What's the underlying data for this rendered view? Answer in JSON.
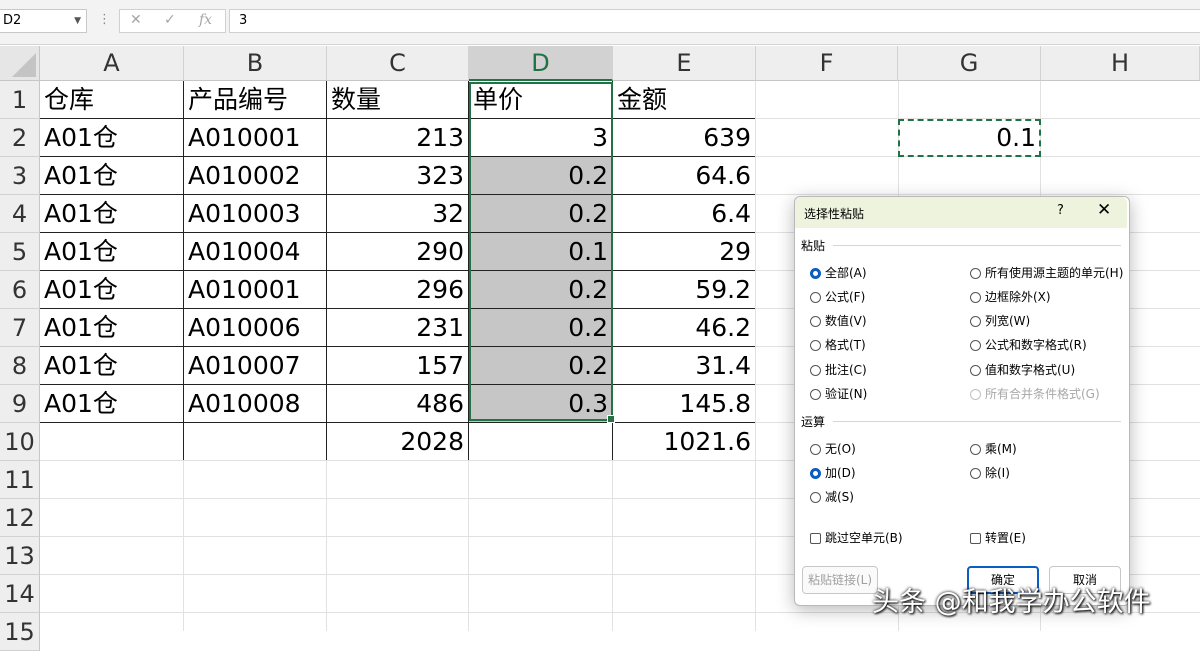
{
  "formula_bar": {
    "name_box": "D2",
    "cancel_symbol": "✕",
    "enter_symbol": "✓",
    "function_symbol": "fx",
    "formula": "3"
  },
  "columns": [
    "A",
    "B",
    "C",
    "D",
    "E",
    "F",
    "G",
    "H"
  ],
  "rows": [
    "1",
    "2",
    "3",
    "4",
    "5",
    "6",
    "7",
    "8",
    "9",
    "10",
    "11",
    "12",
    "13",
    "14",
    "15"
  ],
  "table": {
    "headers": [
      "仓库",
      "产品编号",
      "数量",
      "单价",
      "金额"
    ],
    "data": [
      [
        "A01仓",
        "A010001",
        "213",
        "3",
        "639"
      ],
      [
        "A01仓",
        "A010002",
        "323",
        "0.2",
        "64.6"
      ],
      [
        "A01仓",
        "A010003",
        "32",
        "0.2",
        "6.4"
      ],
      [
        "A01仓",
        "A010004",
        "290",
        "0.1",
        "29"
      ],
      [
        "A01仓",
        "A010001",
        "296",
        "0.2",
        "59.2"
      ],
      [
        "A01仓",
        "A010006",
        "231",
        "0.2",
        "46.2"
      ],
      [
        "A01仓",
        "A010007",
        "157",
        "0.2",
        "31.4"
      ],
      [
        "A01仓",
        "A010008",
        "486",
        "0.3",
        "145.8"
      ]
    ],
    "totals": {
      "quantity": "2028",
      "amount": "1021.6"
    }
  },
  "copied_cell": {
    "address": "G2",
    "value": "0.1"
  },
  "dialog": {
    "title": "选择性粘贴",
    "help": "?",
    "close": "✕",
    "paste_group": "粘贴",
    "paste_left": [
      "全部(A)",
      "公式(F)",
      "数值(V)",
      "格式(T)",
      "批注(C)",
      "验证(N)"
    ],
    "paste_right": [
      "所有使用源主题的单元(H)",
      "边框除外(X)",
      "列宽(W)",
      "公式和数字格式(R)",
      "值和数字格式(U)",
      "所有合并条件格式(G)"
    ],
    "operation_group": "运算",
    "operation_left": [
      "无(O)",
      "加(D)",
      "减(S)"
    ],
    "operation_right": [
      "乘(M)",
      "除(I)"
    ],
    "skip_blanks": "跳过空单元(B)",
    "transpose": "转置(E)",
    "paste_link": "粘贴链接(L)",
    "ok": "确定",
    "cancel": "取消"
  },
  "watermark": "头条 @和我学办公软件",
  "colors": {
    "accent": "#217346",
    "selection_fill": "#c6c6c6",
    "radio_selected": "#0a5dc2",
    "dialog_title_bg": "#edf3dd"
  }
}
